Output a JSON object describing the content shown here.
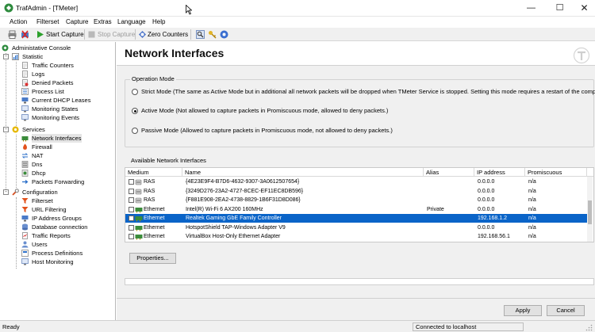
{
  "window": {
    "title": "TrafAdmin - [TMeter]"
  },
  "menu": [
    "Action",
    "Filterset",
    "Capture",
    "Extras",
    "Language",
    "Help"
  ],
  "toolbar": {
    "start_capture": "Start Capture",
    "stop_capture": "Stop Capture",
    "zero_counters": "Zero Counters"
  },
  "tree": {
    "root": "Administative Console",
    "statistic": {
      "label": "Statistic",
      "items": [
        "Traffic Counters",
        "Logs",
        "Denied Packets",
        "Process List",
        "Current DHCP Leases",
        "Monitoring States",
        "Monitoring Events"
      ]
    },
    "services": {
      "label": "Services",
      "items": [
        "Network Interfaces",
        "Firewall",
        "NAT",
        "Dns",
        "Dhcp",
        "Packets Forwarding"
      ]
    },
    "configuration": {
      "label": "Configuration",
      "items": [
        "Filterset",
        "URL Filtering",
        "IP Address Groups",
        "Database connection",
        "Traffic Reports",
        "Users",
        "Process Definitions",
        "Host Monitoring"
      ]
    }
  },
  "page": {
    "title": "Network Interfaces"
  },
  "operation_mode": {
    "title": "Operation Mode",
    "options": [
      {
        "label": "Strict Mode (The same as Active Mode but in additional all network packets will be dropped when TMeter Service is stopped. Setting this mode requires a restart of the computer.)",
        "checked": false
      },
      {
        "label": "Active Mode (Not allowed to capture packets in Promiscuous mode, allowed to deny packets.)",
        "checked": true
      },
      {
        "label": "Passive Mode (Allowed to capture packets in Promiscuous mode, not allowed to deny packets.)",
        "checked": false
      }
    ]
  },
  "interfaces": {
    "title": "Available Network Interfaces",
    "columns": [
      "Medium",
      "Name",
      "Alias",
      "IP address",
      "Promiscuous"
    ],
    "rows": [
      {
        "medium": "RAS",
        "name": "{4E23E9F4-B7D6-4632-9307-3A0612507654}",
        "alias": "",
        "ip": "0.0.0.0",
        "promiscuous": "n/a",
        "selected": false
      },
      {
        "medium": "RAS",
        "name": "{3249D276-23A2-4727-8CEC-EF11EC8DB596}",
        "alias": "",
        "ip": "0.0.0.0",
        "promiscuous": "n/a",
        "selected": false
      },
      {
        "medium": "RAS",
        "name": "{F881E908-2EA2-4738-8829-1B6F31D8D086}",
        "alias": "",
        "ip": "0.0.0.0",
        "promiscuous": "n/a",
        "selected": false
      },
      {
        "medium": "Ethernet",
        "name": "Intel(R) Wi-Fi 6 AX200 160MHz",
        "alias": "Private",
        "ip": "0.0.0.0",
        "promiscuous": "n/a",
        "selected": false
      },
      {
        "medium": "Ethernet",
        "name": "Realtek Gaming GbE Family Controller",
        "alias": "",
        "ip": "192.168.1.2",
        "promiscuous": "n/a",
        "selected": true
      },
      {
        "medium": "Ethernet",
        "name": "HotspotShield TAP-Windows Adapter V9",
        "alias": "",
        "ip": "0.0.0.0",
        "promiscuous": "n/a",
        "selected": false
      },
      {
        "medium": "Ethernet",
        "name": "VirtualBox Host-Only Ethernet Adapter",
        "alias": "",
        "ip": "192.168.56.1",
        "promiscuous": "n/a",
        "selected": false
      }
    ]
  },
  "buttons": {
    "properties": "Properties...",
    "apply": "Apply",
    "cancel": "Cancel"
  },
  "status": {
    "left": "Ready",
    "connection": "Connected to localhost"
  },
  "colors": {
    "selection": "#0a64c8",
    "panel": "#f0f0f0",
    "service_icon": "#e6b800",
    "config_icon": "#d44c1c"
  }
}
